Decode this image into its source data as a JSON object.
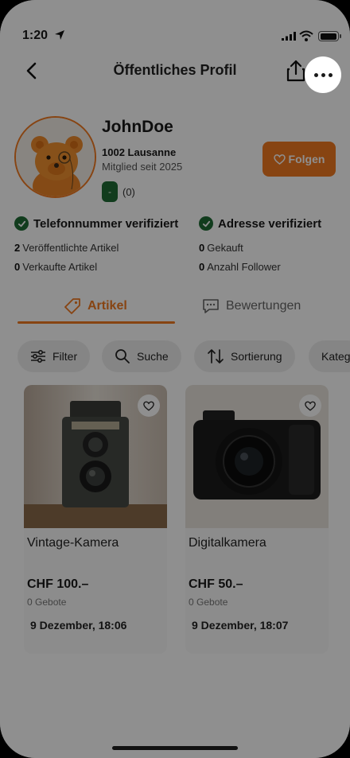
{
  "status_bar": {
    "time": "1:20"
  },
  "nav": {
    "title": "Öffentliches Profil"
  },
  "profile": {
    "username": "JohnDoe",
    "location": "1002 Lausanne",
    "member_since": "Mitglied seit 2025",
    "rating_badge": "-",
    "rating_count": "(0)",
    "follow_label": "Folgen"
  },
  "verifications": [
    {
      "label": "Telefonnummer verifiziert"
    },
    {
      "label": "Adresse verifiziert"
    }
  ],
  "stats": [
    {
      "value": "2",
      "label": "Veröffentlichte Artikel"
    },
    {
      "value": "0",
      "label": "Gekauft"
    },
    {
      "value": "0",
      "label": "Verkaufte Artikel"
    },
    {
      "value": "0",
      "label": "Anzahl Follower"
    }
  ],
  "tabs": [
    {
      "label": "Artikel",
      "active": true
    },
    {
      "label": "Bewertungen",
      "active": false
    }
  ],
  "filters": [
    {
      "label": "Filter"
    },
    {
      "label": "Suche"
    },
    {
      "label": "Sortierung"
    },
    {
      "label": "Kateg"
    }
  ],
  "products": [
    {
      "title": "Vintage-Kamera",
      "price": "CHF 100.–",
      "bids": "0 Gebote",
      "date": "9 Dezember, 18:06"
    },
    {
      "title": "Digitalkamera",
      "price": "CHF 50.–",
      "bids": "0 Gebote",
      "date": "9 Dezember, 18:07"
    }
  ],
  "colors": {
    "accent": "#f07a21",
    "verified": "#1f6b35",
    "overlay": "rgba(0,0,0,0.44)"
  },
  "icons": [
    "location-arrow-icon",
    "signal-icon",
    "wifi-icon",
    "battery-icon",
    "back-chevron-icon",
    "share-icon",
    "more-dots-icon",
    "heart-icon",
    "check-icon",
    "tag-icon",
    "chat-icon",
    "sliders-icon",
    "search-icon",
    "sort-icon"
  ]
}
